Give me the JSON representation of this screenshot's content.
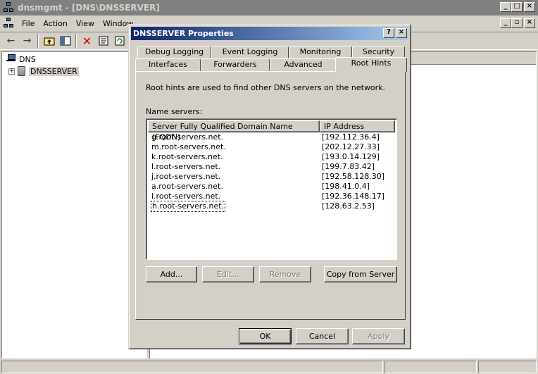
{
  "window": {
    "title": "dnsmgmt - [DNS\\DNSSERVER]",
    "min": "_",
    "max": "□",
    "close": "×",
    "mdi_min": "_",
    "mdi_restore": "▫",
    "mdi_close": "×"
  },
  "menu": {
    "file": "File",
    "action": "Action",
    "view": "View",
    "window": "Window"
  },
  "toolbar": [
    "back-icon",
    "forward-icon",
    "up-folder-icon",
    "show-tree-icon",
    "delete-icon",
    "properties-icon",
    "refresh-icon"
  ],
  "tree": {
    "root": "DNS",
    "server": "DNSSERVER",
    "expander": "+"
  },
  "dialog": {
    "title": "DNSSERVER Properties",
    "help": "?",
    "close": "×",
    "tabs_back": [
      "Debug Logging",
      "Event Logging",
      "Monitoring",
      "Security"
    ],
    "tabs_front": [
      "Interfaces",
      "Forwarders",
      "Advanced",
      "Root Hints"
    ],
    "intro": "Root hints are used to find other DNS servers on the network.",
    "name_servers_label": "Name servers:",
    "columns": {
      "fqdn": "Server Fully Qualified Domain Name (FQDN)",
      "ip": "IP Address"
    },
    "rows": [
      {
        "fqdn": "g.root-servers.net.",
        "ip": "[192.112.36.4]"
      },
      {
        "fqdn": "m.root-servers.net.",
        "ip": "[202.12.27.33]"
      },
      {
        "fqdn": "k.root-servers.net.",
        "ip": "[193.0.14.129]"
      },
      {
        "fqdn": "l.root-servers.net.",
        "ip": "[199.7.83.42]"
      },
      {
        "fqdn": "j.root-servers.net.",
        "ip": "[192.58.128.30]"
      },
      {
        "fqdn": "a.root-servers.net.",
        "ip": "[198.41.0.4]"
      },
      {
        "fqdn": "i.root-servers.net.",
        "ip": "[192.36.148.17]"
      },
      {
        "fqdn": "h.root-servers.net.",
        "ip": "[128.63.2.53]"
      }
    ],
    "buttons": {
      "add": "Add...",
      "edit": "Edit...",
      "remove": "Remove",
      "copy": "Copy from Server",
      "ok": "OK",
      "cancel": "Cancel",
      "apply": "Apply"
    }
  }
}
